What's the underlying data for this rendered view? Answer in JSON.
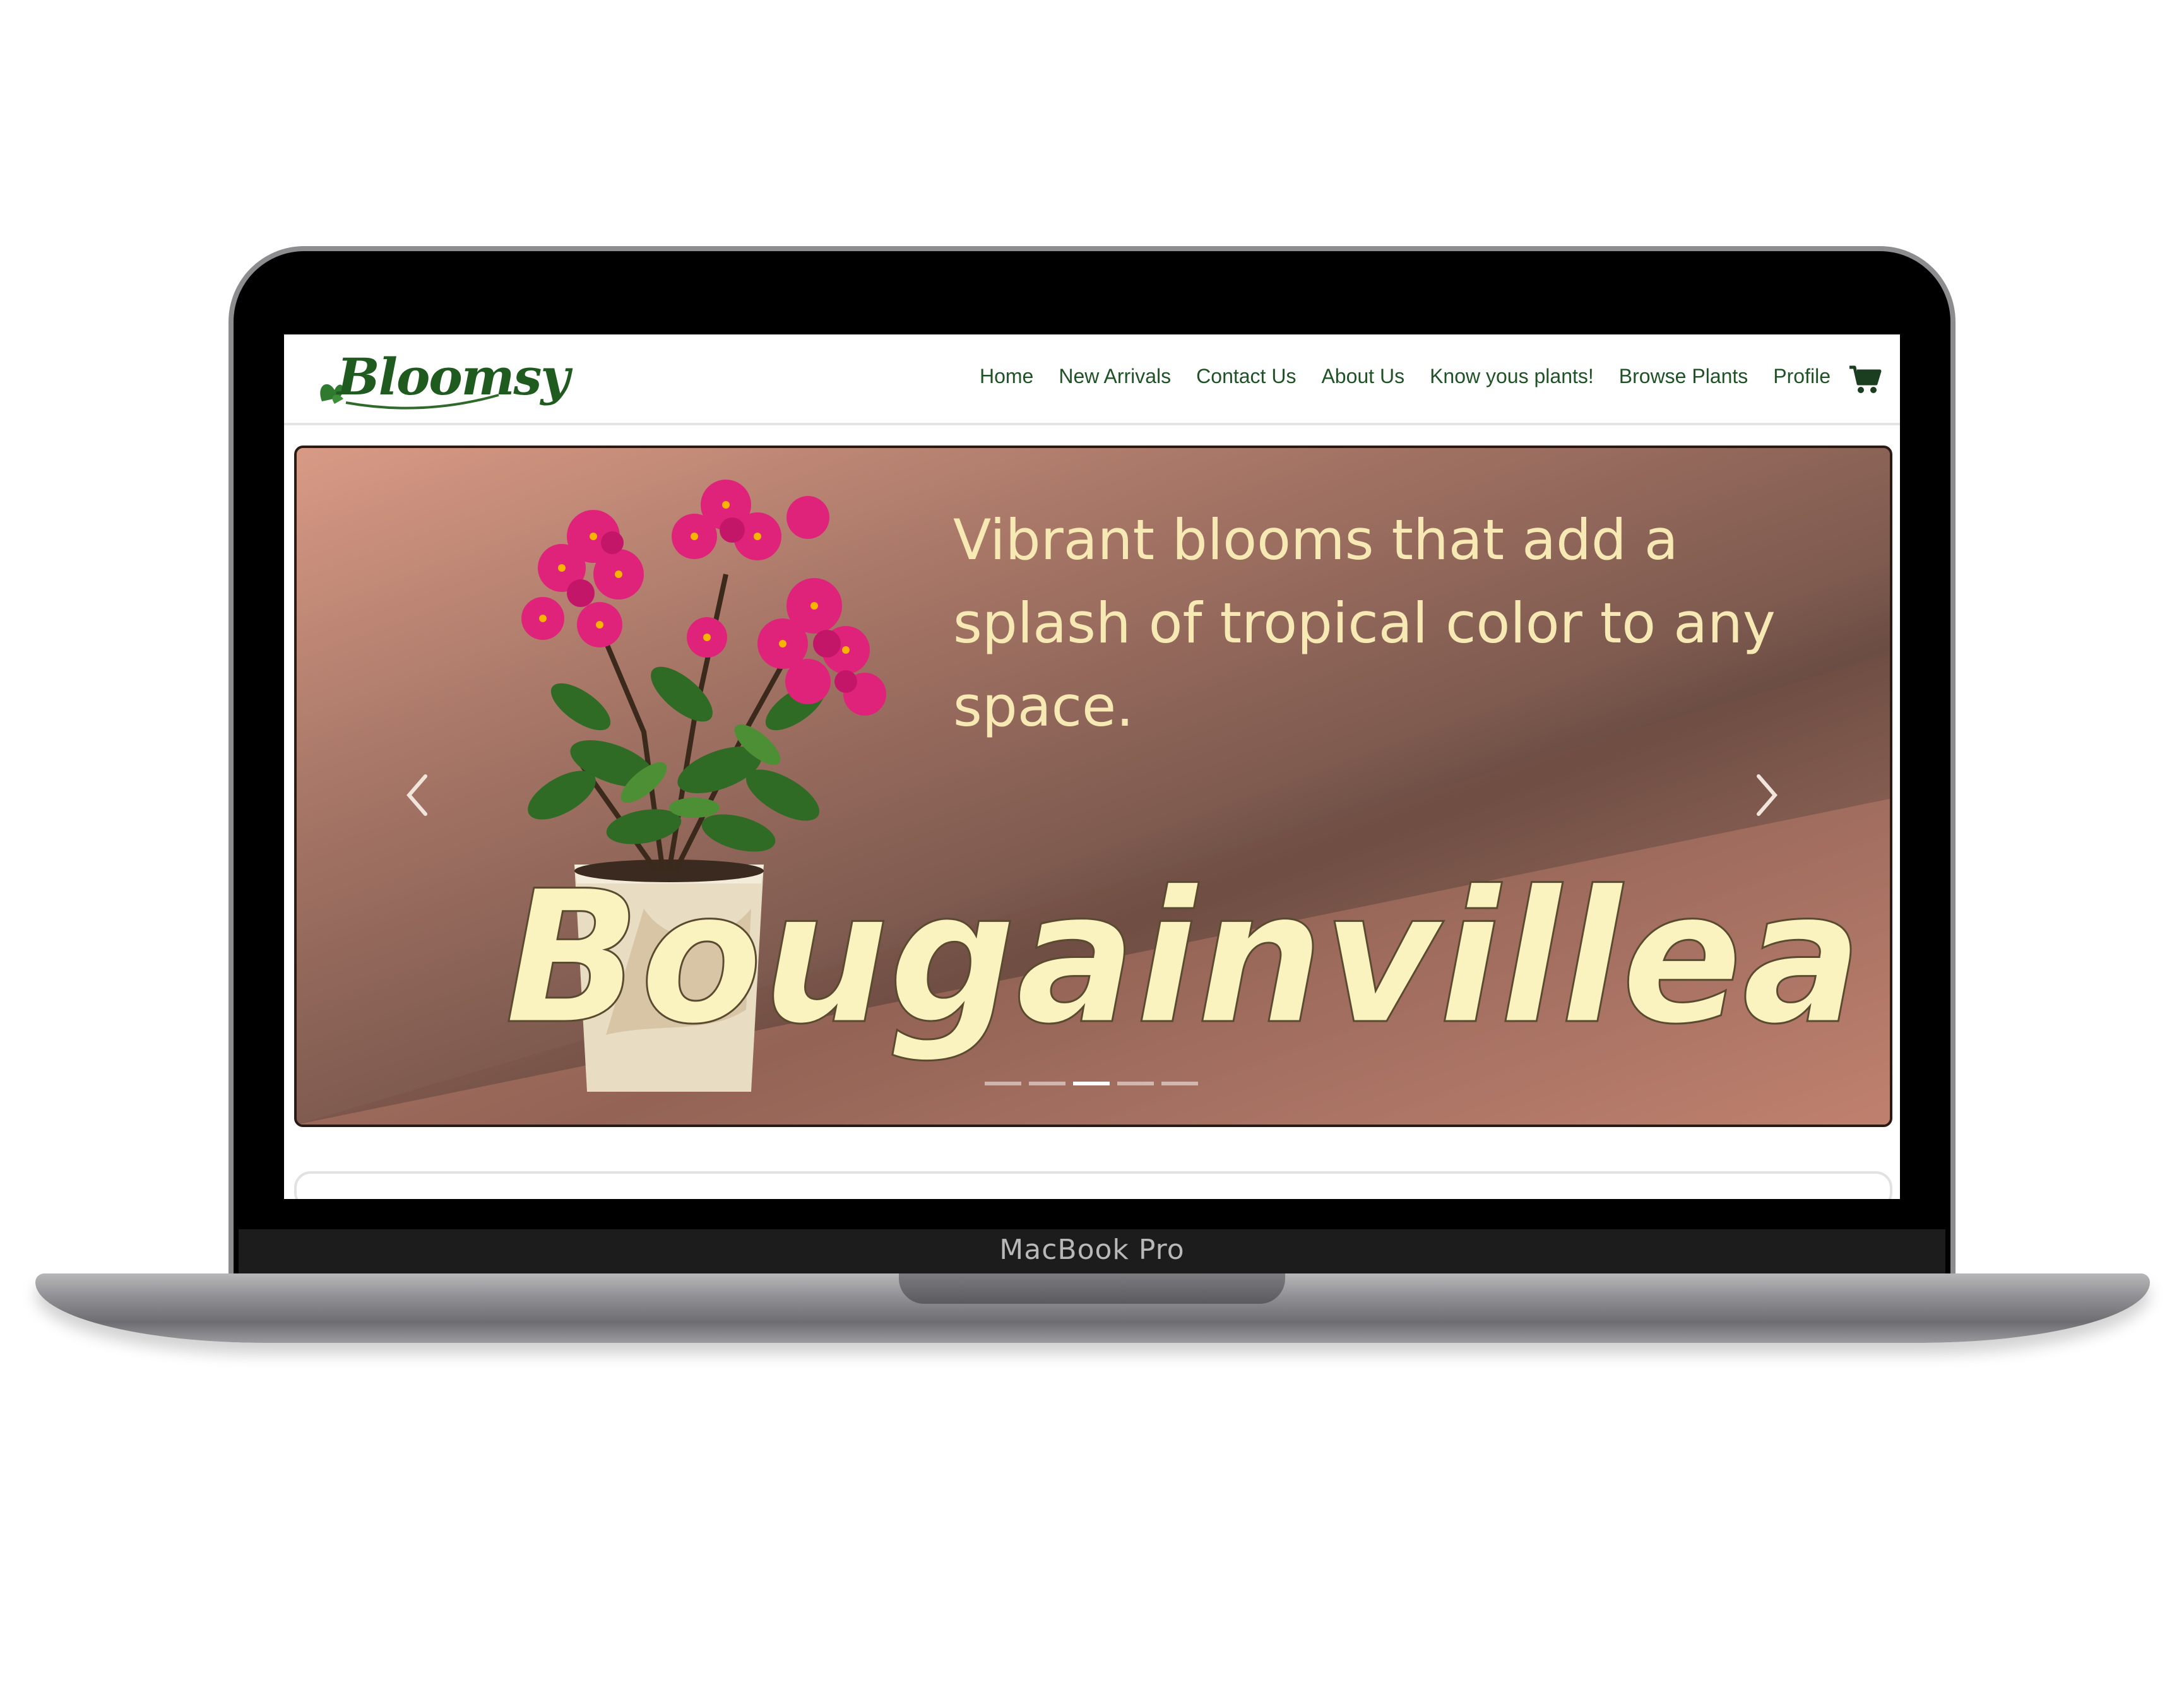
{
  "device": {
    "label": "MacBook Pro"
  },
  "site": {
    "logo_text": "Bloomsy",
    "nav": [
      {
        "label": "Home"
      },
      {
        "label": "New Arrivals"
      },
      {
        "label": "Contact Us"
      },
      {
        "label": "About Us"
      },
      {
        "label": "Know yous plants!"
      },
      {
        "label": "Browse Plants"
      },
      {
        "label": "Profile"
      }
    ],
    "cart_icon": "cart-icon"
  },
  "hero": {
    "tagline": "Vibrant blooms that add a splash of tropical color to any space.",
    "plant_name": "Bougainvillea",
    "slide_count": 5,
    "active_slide": 3
  },
  "colors": {
    "nav_text": "#1f5326",
    "logo_green": "#1f5a1f",
    "tagline": "#f7e9b3",
    "hero_word": "#fbf3bf",
    "flower_pink": "#e0237a"
  }
}
